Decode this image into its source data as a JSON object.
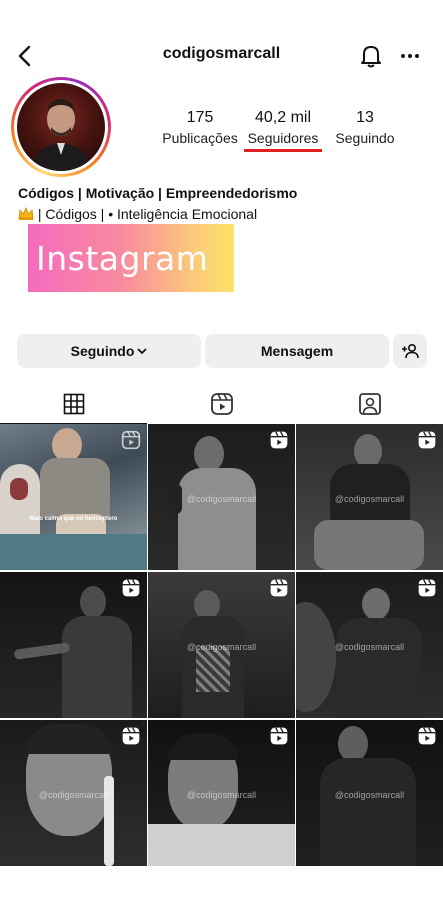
{
  "header": {
    "username": "codigosmarcall",
    "icons": [
      "back-arrow-icon",
      "bell-icon",
      "more-horizontal-icon"
    ]
  },
  "stats": [
    {
      "value": "175",
      "label": "Publicações"
    },
    {
      "value": "40,2 mil",
      "label": "Seguidores"
    },
    {
      "value": "13",
      "label": "Seguindo"
    }
  ],
  "bio": {
    "name": "Códigos | Motivação | Empreendedorismo",
    "line2_text": " | Códigos | • Inteligência Emocional",
    "line2_icon": "crown-icon"
  },
  "banner": {
    "text": "Instagram"
  },
  "buttons": {
    "following": "Seguindo",
    "message": "Mensagem"
  },
  "tabs": [
    "grid-icon",
    "reels-icon",
    "tagged-icon"
  ],
  "posts": [
    {
      "caption": "Mais calmo que no helicoptero",
      "watermark": ""
    },
    {
      "caption": "",
      "watermark": "@codigosmarcall"
    },
    {
      "caption": "",
      "watermark": "@codigosmarcall"
    },
    {
      "caption": "",
      "watermark": ""
    },
    {
      "caption": "",
      "watermark": "@codigosmarcall"
    },
    {
      "caption": "",
      "watermark": "@codigosmarcall"
    },
    {
      "caption": "",
      "watermark": "@codigosmarcall"
    },
    {
      "caption": "",
      "watermark": "@codigosmarcall"
    },
    {
      "caption": "",
      "watermark": "@codigosmarcall"
    }
  ],
  "colors": {
    "highlight_underline": "#e02020",
    "button_bg": "#efefef"
  }
}
